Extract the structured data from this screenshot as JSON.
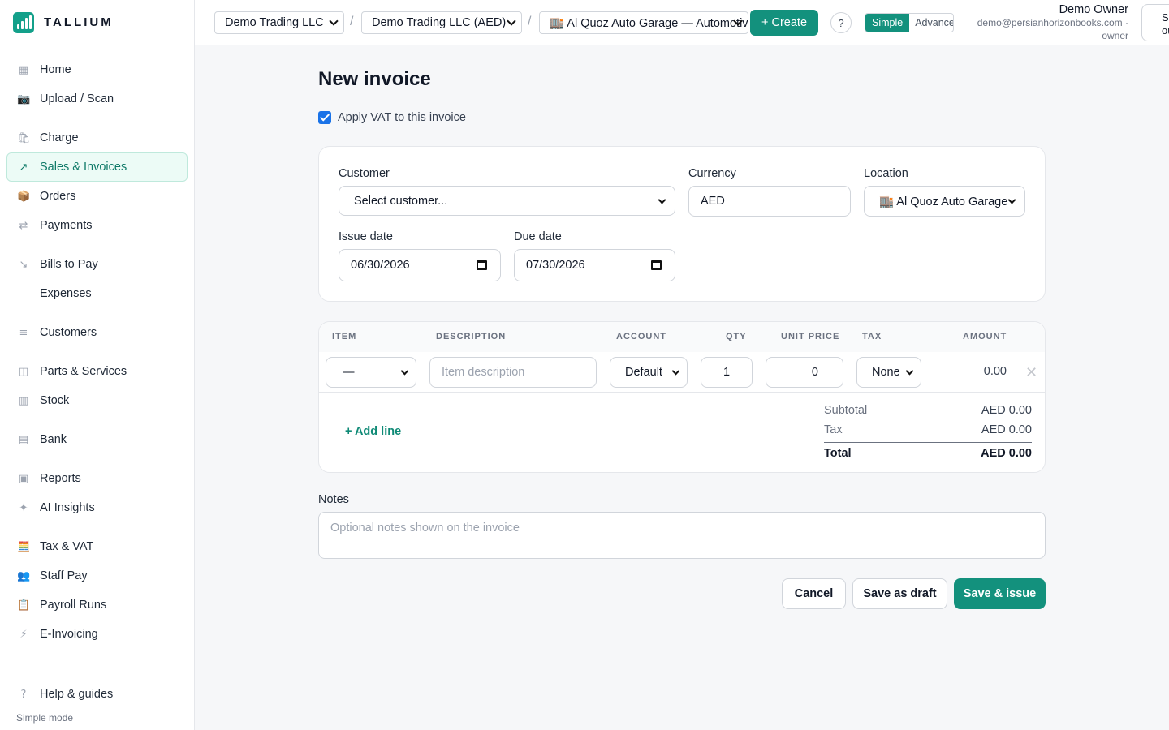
{
  "brand": {
    "name": "TALLIUM"
  },
  "sidebar": {
    "items": [
      {
        "label": "Home",
        "icon": "grid-icon",
        "glyph": "▦"
      },
      {
        "label": "Upload / Scan",
        "icon": "camera-icon",
        "glyph": "📷"
      },
      {
        "label": "Charge",
        "icon": "shopping-bag-icon",
        "glyph": "🛍"
      },
      {
        "label": "Sales & Invoices",
        "icon": "arrow-up-right-icon",
        "glyph": "↗",
        "active": true
      },
      {
        "label": "Orders",
        "icon": "package-icon",
        "glyph": "📦"
      },
      {
        "label": "Payments",
        "icon": "transfer-arrows-icon",
        "glyph": "⇄"
      },
      {
        "label": "Bills to Pay",
        "icon": "arrow-down-right-icon",
        "glyph": "↘"
      },
      {
        "label": "Expenses",
        "icon": "minus-icon",
        "glyph": "–"
      },
      {
        "label": "Customers",
        "icon": "list-icon",
        "glyph": "≡"
      },
      {
        "label": "Parts & Services",
        "icon": "columns-icon",
        "glyph": "◫"
      },
      {
        "label": "Stock",
        "icon": "stock-icon",
        "glyph": "▥"
      },
      {
        "label": "Bank",
        "icon": "bank-icon",
        "glyph": "▤"
      },
      {
        "label": "Reports",
        "icon": "report-icon",
        "glyph": "▣"
      },
      {
        "label": "AI Insights",
        "icon": "sparkle-icon",
        "glyph": "✦"
      },
      {
        "label": "Tax & VAT",
        "icon": "abacus-icon",
        "glyph": "🧮"
      },
      {
        "label": "Staff Pay",
        "icon": "people-icon",
        "glyph": "👥"
      },
      {
        "label": "Payroll Runs",
        "icon": "clipboard-icon",
        "glyph": "📋"
      },
      {
        "label": "E-Invoicing",
        "icon": "lightning-icon",
        "glyph": "⚡"
      }
    ],
    "footer": {
      "help_label": "Help & guides",
      "help_glyph": "?",
      "mode_note": "Simple mode"
    }
  },
  "topbar": {
    "company": "Demo Trading LLC",
    "ledger": "Demo Trading LLC (AED)",
    "location": "🏬 Al Quoz Auto Garage — Automotive",
    "separator": "/",
    "create_label": "+ Create",
    "help_label": "?",
    "mode_simple": "Simple",
    "mode_advanced": "Advanced",
    "user_name": "Demo Owner",
    "user_email": "demo@persianhorizonbooks.com ·",
    "user_role": "owner",
    "signout_label": "Sign out"
  },
  "page": {
    "title": "New invoice",
    "apply_vat_label": "Apply VAT to this invoice",
    "apply_vat_checked": true
  },
  "form": {
    "customer_label": "Customer",
    "customer_value": "Select customer...",
    "currency_label": "Currency",
    "currency_value": "AED",
    "location_label": "Location",
    "location_value": "🏬 Al Quoz Auto Garage",
    "issue_date_label": "Issue date",
    "issue_date_value": "06/30/2026",
    "due_date_label": "Due date",
    "due_date_value": "07/30/2026"
  },
  "lines": {
    "headers": [
      "ITEM",
      "DESCRIPTION",
      "ACCOUNT",
      "QTY",
      "UNIT PRICE",
      "TAX",
      "AMOUNT"
    ],
    "row": {
      "item": "—",
      "description_placeholder": "Item description",
      "account": "Default",
      "qty": "1",
      "unit_price": "0",
      "tax": "None",
      "amount": "0.00",
      "remove_glyph": "✕"
    },
    "add_line_label": "+ Add line"
  },
  "totals": {
    "subtotal_label": "Subtotal",
    "subtotal_value": "AED 0.00",
    "tax_label": "Tax",
    "tax_value": "AED 0.00",
    "total_label": "Total",
    "total_value": "AED 0.00"
  },
  "notes": {
    "label": "Notes",
    "placeholder": "Optional notes shown on the invoice"
  },
  "actions": {
    "cancel": "Cancel",
    "save_draft": "Save as draft",
    "save_issue": "Save & issue"
  },
  "colors": {
    "accent": "#13917d",
    "active_bg": "#ecfbf6",
    "checkbox": "#1a73e8"
  }
}
